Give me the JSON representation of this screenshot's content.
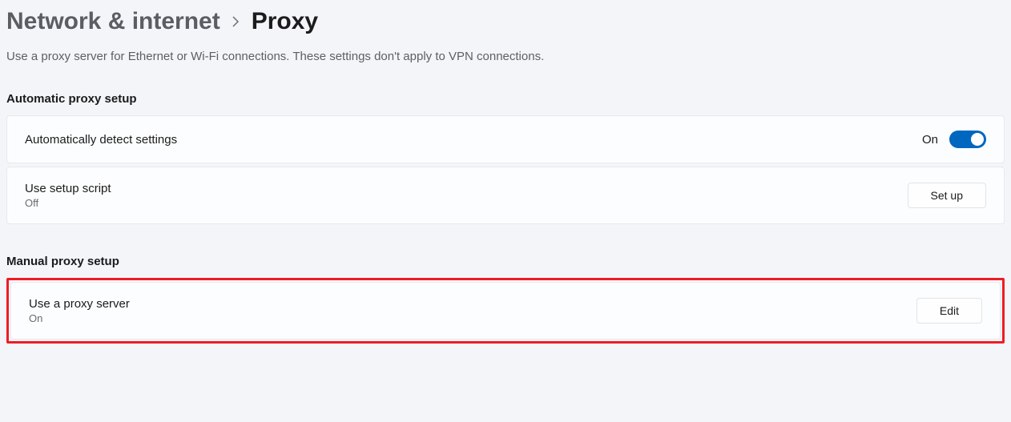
{
  "breadcrumb": {
    "parent": "Network & internet",
    "current": "Proxy"
  },
  "description": "Use a proxy server for Ethernet or Wi-Fi connections. These settings don't apply to VPN connections.",
  "sections": {
    "automatic": {
      "title": "Automatic proxy setup",
      "detect": {
        "label": "Automatically detect settings",
        "state_label": "On"
      },
      "script": {
        "label": "Use setup script",
        "status": "Off",
        "button": "Set up"
      }
    },
    "manual": {
      "title": "Manual proxy setup",
      "proxy": {
        "label": "Use a proxy server",
        "status": "On",
        "button": "Edit"
      }
    }
  }
}
